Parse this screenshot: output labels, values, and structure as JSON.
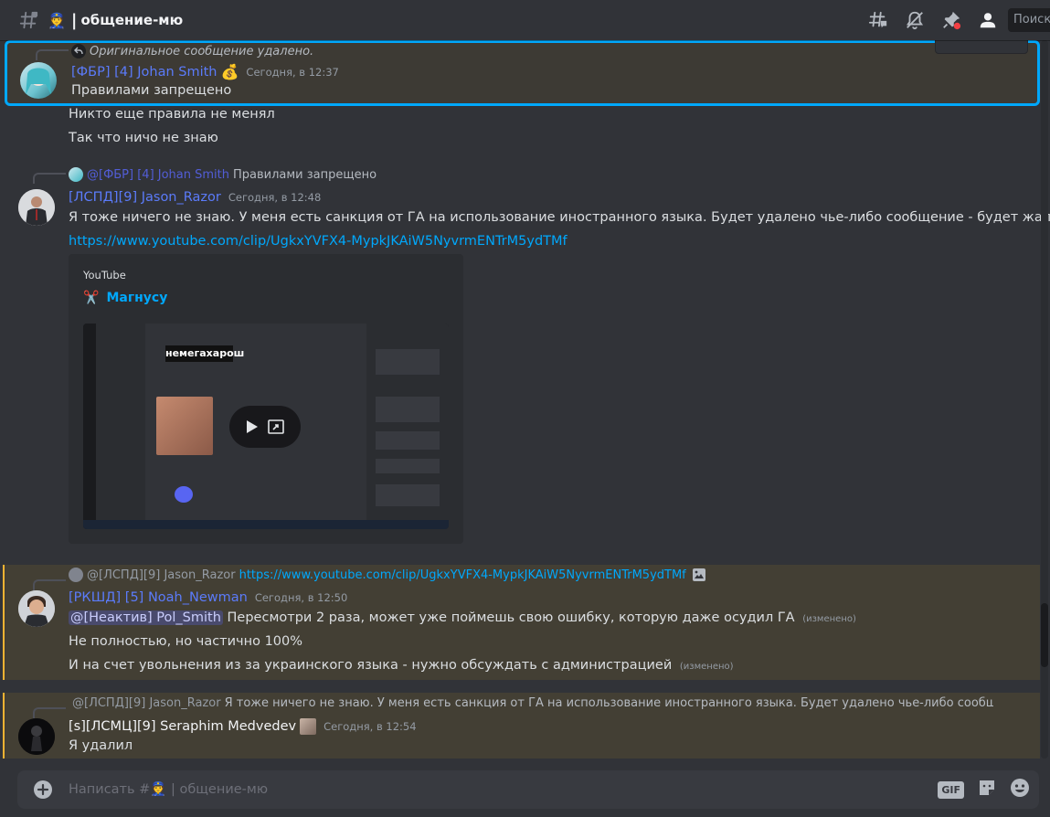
{
  "header": {
    "channel_emoji": "👮",
    "separator": "|",
    "channel_name": "общение-мю",
    "search_placeholder": "Поиск"
  },
  "messages": {
    "m1": {
      "reply_text": "Оригинальное сообщение удалено.",
      "author": "[ФБР] [4] Johan Smith",
      "author_badge": "💰",
      "time": "Сегодня, в 12:37",
      "lines": [
        "Правилами запрещено",
        "Никто еще правила не менял",
        "Так что ничо не знаю"
      ]
    },
    "m2": {
      "reply_author": "@[ФБР] [4] Johan Smith",
      "reply_text": "Правилами запрещено",
      "author": "[ЛСПД][9] Jason_Razor",
      "time": "Сегодня, в 12:48",
      "lines": [
        "Я тоже ничего не знаю. У меня есть санкция от ГА на использование иностранного языка. Будет удалено чье-либо сообщение - будет жалоба"
      ],
      "link": "https://www.youtube.com/clip/UgkxYVFX4-MypkJKAiW5NyvrmENTrM5ydTMf",
      "embed": {
        "provider": "YouTube",
        "title_emoji": "✂️",
        "title": "Магнусу",
        "thumb_caption": "немегахарош"
      }
    },
    "m3": {
      "reply_author": "@[ЛСПД][9] Jason_Razor",
      "reply_text": "https://www.youtube.com/clip/UgkxYVFX4-MypkJKAiW5NyvrmENTrM5ydTMf",
      "author": "[РКШД] [5] Noah_Newman",
      "time": "Сегодня, в 12:50",
      "mention": "@[Неактив] Pol_Smith",
      "line1": "Пересмотри 2 раза, может уже поймешь свою ошибку, которую даже осудил ГА",
      "edited": "(изменено)",
      "line2": "Не полностью, но частично 100%",
      "line3": "И на счет увольнения из за украинского языка - нужно обсуждать с администрацией"
    },
    "m4": {
      "reply_author": "@[ЛСПД][9] Jason_Razor",
      "reply_text": "Я тоже ничего не знаю. У меня есть санкция от ГА на использование иностранного языка. Будет удалено чье-либо сообщение - будет жал",
      "author": "[s][ЛСМЦ][9] Seraphim Medvedev",
      "time": "Сегодня, в 12:54",
      "line1": "Я удалил"
    }
  },
  "composer": {
    "placeholder": "Написать #👮 | общение-мю",
    "gif_label": "GIF"
  },
  "colors": {
    "background": "#313338",
    "link": "#00a8fc",
    "author_blue": "#5b7bfa",
    "author_white": "#f2f3f5",
    "highlight_border": "#00a8fc",
    "mention_bar": "#f0b232"
  }
}
